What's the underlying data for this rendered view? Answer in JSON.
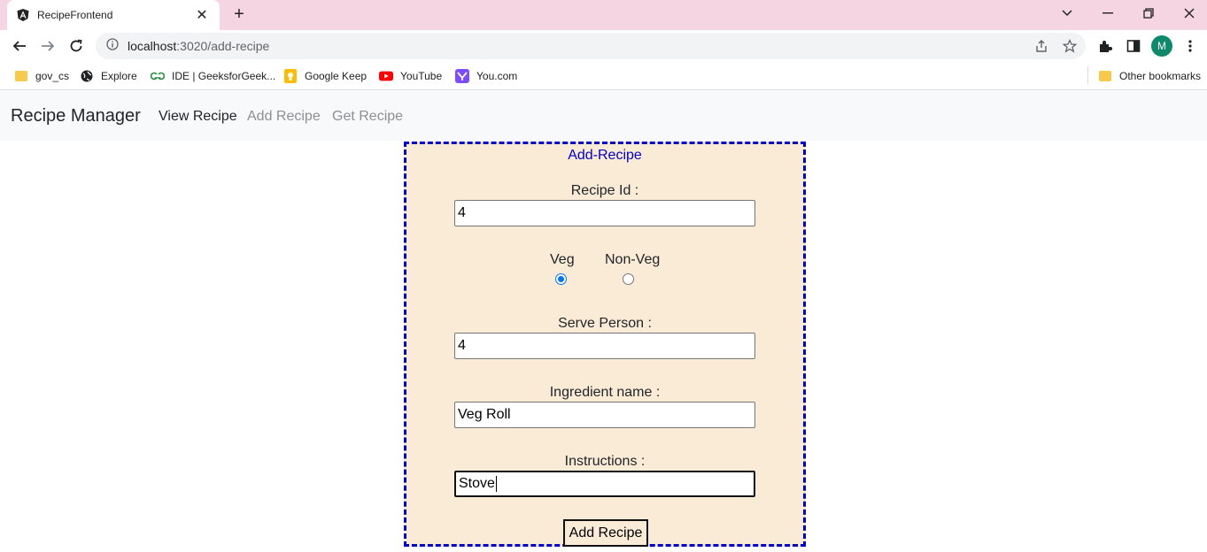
{
  "browser": {
    "tab": {
      "title": "RecipeFrontend",
      "close_glyph": "✕"
    },
    "new_tab_glyph": "+",
    "window_controls": {
      "dropdown": "⌄",
      "minimize": "—",
      "restore": "❐",
      "close": "✕"
    },
    "url": {
      "host": "localhost",
      "path": ":3020/add-recipe"
    },
    "profile_initial": "M",
    "bookmarks": [
      {
        "label": "gov_cs",
        "icon": "folder-icon"
      },
      {
        "label": "Explore",
        "icon": "globe-icon"
      },
      {
        "label": "IDE | GeeksforGeek...",
        "icon": "geeksforgeeks-icon"
      },
      {
        "label": "Google Keep",
        "icon": "keep-icon"
      },
      {
        "label": "YouTube",
        "icon": "youtube-icon"
      },
      {
        "label": "You.com",
        "icon": "youcom-icon"
      }
    ],
    "other_bookmarks": "Other bookmarks"
  },
  "app": {
    "brand": "Recipe Manager",
    "nav": [
      {
        "label": "View Recipe"
      },
      {
        "label": "Add Recipe"
      },
      {
        "label": "Get Recipe"
      }
    ]
  },
  "form": {
    "title": "Add-Recipe",
    "recipe_id": {
      "label": "Recipe Id :",
      "value": "4"
    },
    "type": {
      "veg_label": "Veg",
      "nonveg_label": "Non-Veg",
      "selected": "Veg"
    },
    "serve": {
      "label": "Serve Person :",
      "value": "4"
    },
    "ingredient": {
      "label": "Ingredient name :",
      "value": "Veg Roll"
    },
    "instructions": {
      "label": "Instructions :",
      "value": "Stove"
    },
    "submit_label": "Add Recipe"
  },
  "colors": {
    "tabstrip": "#f6d5e3",
    "card_bg": "#faebd7",
    "card_border": "#0000cd",
    "radio_accent": "#0075ff"
  }
}
